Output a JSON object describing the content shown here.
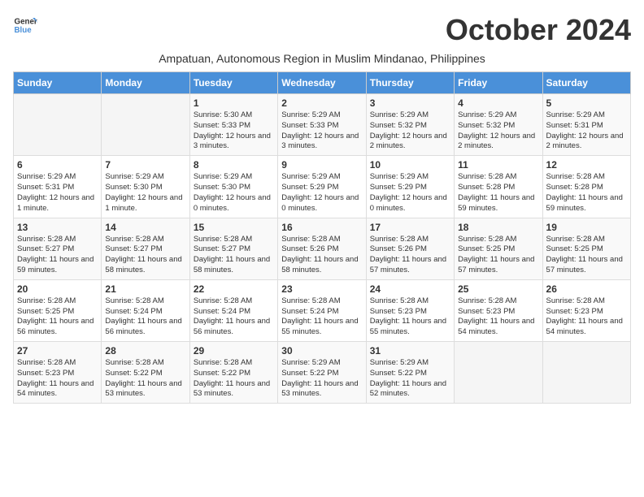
{
  "header": {
    "logo_general": "General",
    "logo_blue": "Blue",
    "month_title": "October 2024",
    "subtitle": "Ampatuan, Autonomous Region in Muslim Mindanao, Philippines"
  },
  "days_of_week": [
    "Sunday",
    "Monday",
    "Tuesday",
    "Wednesday",
    "Thursday",
    "Friday",
    "Saturday"
  ],
  "weeks": [
    [
      {
        "day": "",
        "empty": true
      },
      {
        "day": "",
        "empty": true
      },
      {
        "day": "1",
        "sunrise": "Sunrise: 5:30 AM",
        "sunset": "Sunset: 5:33 PM",
        "daylight": "Daylight: 12 hours and 3 minutes."
      },
      {
        "day": "2",
        "sunrise": "Sunrise: 5:29 AM",
        "sunset": "Sunset: 5:33 PM",
        "daylight": "Daylight: 12 hours and 3 minutes."
      },
      {
        "day": "3",
        "sunrise": "Sunrise: 5:29 AM",
        "sunset": "Sunset: 5:32 PM",
        "daylight": "Daylight: 12 hours and 2 minutes."
      },
      {
        "day": "4",
        "sunrise": "Sunrise: 5:29 AM",
        "sunset": "Sunset: 5:32 PM",
        "daylight": "Daylight: 12 hours and 2 minutes."
      },
      {
        "day": "5",
        "sunrise": "Sunrise: 5:29 AM",
        "sunset": "Sunset: 5:31 PM",
        "daylight": "Daylight: 12 hours and 2 minutes."
      }
    ],
    [
      {
        "day": "6",
        "sunrise": "Sunrise: 5:29 AM",
        "sunset": "Sunset: 5:31 PM",
        "daylight": "Daylight: 12 hours and 1 minute."
      },
      {
        "day": "7",
        "sunrise": "Sunrise: 5:29 AM",
        "sunset": "Sunset: 5:30 PM",
        "daylight": "Daylight: 12 hours and 1 minute."
      },
      {
        "day": "8",
        "sunrise": "Sunrise: 5:29 AM",
        "sunset": "Sunset: 5:30 PM",
        "daylight": "Daylight: 12 hours and 0 minutes."
      },
      {
        "day": "9",
        "sunrise": "Sunrise: 5:29 AM",
        "sunset": "Sunset: 5:29 PM",
        "daylight": "Daylight: 12 hours and 0 minutes."
      },
      {
        "day": "10",
        "sunrise": "Sunrise: 5:29 AM",
        "sunset": "Sunset: 5:29 PM",
        "daylight": "Daylight: 12 hours and 0 minutes."
      },
      {
        "day": "11",
        "sunrise": "Sunrise: 5:28 AM",
        "sunset": "Sunset: 5:28 PM",
        "daylight": "Daylight: 11 hours and 59 minutes."
      },
      {
        "day": "12",
        "sunrise": "Sunrise: 5:28 AM",
        "sunset": "Sunset: 5:28 PM",
        "daylight": "Daylight: 11 hours and 59 minutes."
      }
    ],
    [
      {
        "day": "13",
        "sunrise": "Sunrise: 5:28 AM",
        "sunset": "Sunset: 5:27 PM",
        "daylight": "Daylight: 11 hours and 59 minutes."
      },
      {
        "day": "14",
        "sunrise": "Sunrise: 5:28 AM",
        "sunset": "Sunset: 5:27 PM",
        "daylight": "Daylight: 11 hours and 58 minutes."
      },
      {
        "day": "15",
        "sunrise": "Sunrise: 5:28 AM",
        "sunset": "Sunset: 5:27 PM",
        "daylight": "Daylight: 11 hours and 58 minutes."
      },
      {
        "day": "16",
        "sunrise": "Sunrise: 5:28 AM",
        "sunset": "Sunset: 5:26 PM",
        "daylight": "Daylight: 11 hours and 58 minutes."
      },
      {
        "day": "17",
        "sunrise": "Sunrise: 5:28 AM",
        "sunset": "Sunset: 5:26 PM",
        "daylight": "Daylight: 11 hours and 57 minutes."
      },
      {
        "day": "18",
        "sunrise": "Sunrise: 5:28 AM",
        "sunset": "Sunset: 5:25 PM",
        "daylight": "Daylight: 11 hours and 57 minutes."
      },
      {
        "day": "19",
        "sunrise": "Sunrise: 5:28 AM",
        "sunset": "Sunset: 5:25 PM",
        "daylight": "Daylight: 11 hours and 57 minutes."
      }
    ],
    [
      {
        "day": "20",
        "sunrise": "Sunrise: 5:28 AM",
        "sunset": "Sunset: 5:25 PM",
        "daylight": "Daylight: 11 hours and 56 minutes."
      },
      {
        "day": "21",
        "sunrise": "Sunrise: 5:28 AM",
        "sunset": "Sunset: 5:24 PM",
        "daylight": "Daylight: 11 hours and 56 minutes."
      },
      {
        "day": "22",
        "sunrise": "Sunrise: 5:28 AM",
        "sunset": "Sunset: 5:24 PM",
        "daylight": "Daylight: 11 hours and 56 minutes."
      },
      {
        "day": "23",
        "sunrise": "Sunrise: 5:28 AM",
        "sunset": "Sunset: 5:24 PM",
        "daylight": "Daylight: 11 hours and 55 minutes."
      },
      {
        "day": "24",
        "sunrise": "Sunrise: 5:28 AM",
        "sunset": "Sunset: 5:23 PM",
        "daylight": "Daylight: 11 hours and 55 minutes."
      },
      {
        "day": "25",
        "sunrise": "Sunrise: 5:28 AM",
        "sunset": "Sunset: 5:23 PM",
        "daylight": "Daylight: 11 hours and 54 minutes."
      },
      {
        "day": "26",
        "sunrise": "Sunrise: 5:28 AM",
        "sunset": "Sunset: 5:23 PM",
        "daylight": "Daylight: 11 hours and 54 minutes."
      }
    ],
    [
      {
        "day": "27",
        "sunrise": "Sunrise: 5:28 AM",
        "sunset": "Sunset: 5:23 PM",
        "daylight": "Daylight: 11 hours and 54 minutes."
      },
      {
        "day": "28",
        "sunrise": "Sunrise: 5:28 AM",
        "sunset": "Sunset: 5:22 PM",
        "daylight": "Daylight: 11 hours and 53 minutes."
      },
      {
        "day": "29",
        "sunrise": "Sunrise: 5:28 AM",
        "sunset": "Sunset: 5:22 PM",
        "daylight": "Daylight: 11 hours and 53 minutes."
      },
      {
        "day": "30",
        "sunrise": "Sunrise: 5:29 AM",
        "sunset": "Sunset: 5:22 PM",
        "daylight": "Daylight: 11 hours and 53 minutes."
      },
      {
        "day": "31",
        "sunrise": "Sunrise: 5:29 AM",
        "sunset": "Sunset: 5:22 PM",
        "daylight": "Daylight: 11 hours and 52 minutes."
      },
      {
        "day": "",
        "empty": true
      },
      {
        "day": "",
        "empty": true
      }
    ]
  ]
}
